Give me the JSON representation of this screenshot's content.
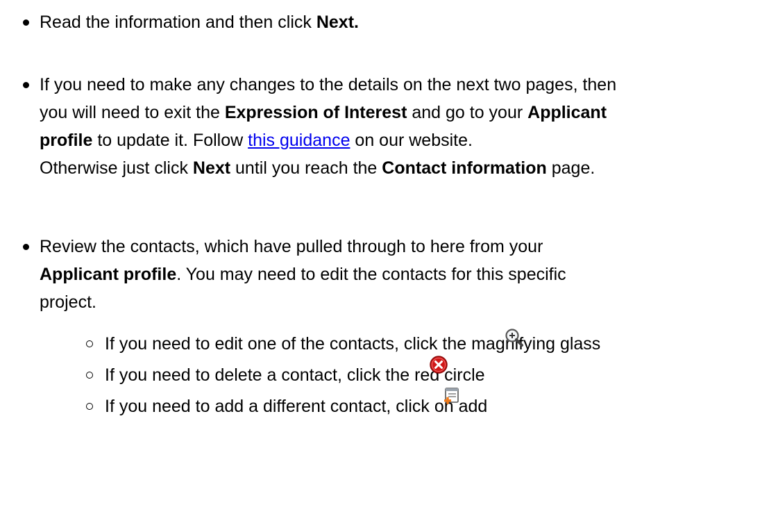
{
  "bullets": [
    {
      "lines": [
        [
          {
            "t": "Read the information and then click "
          },
          {
            "t": "Next.",
            "b": true
          }
        ]
      ]
    },
    {
      "lines": [
        [
          {
            "t": "If you need to make any changes to the details on the next two pages, then"
          }
        ],
        [
          {
            "t": "you will need to exit the "
          },
          {
            "t": "Expression of Interest",
            "b": true
          },
          {
            "t": " and go to your "
          },
          {
            "t": "Applicant",
            "b": true
          }
        ],
        [
          {
            "t": "profile",
            "b": true
          },
          {
            "t": " to update it. Follow "
          },
          {
            "t": "this guidance",
            "link": true
          },
          {
            "t": " on our website."
          }
        ],
        [
          {
            "t": "Otherwise just click "
          },
          {
            "t": "Next",
            "b": true
          },
          {
            "t": " until you reach the "
          },
          {
            "t": "Contact information",
            "b": true
          },
          {
            "t": " page."
          }
        ]
      ]
    },
    {
      "lines": [
        [
          {
            "t": "Review the contacts, which have pulled through to here from your"
          }
        ],
        [
          {
            "t": "Applicant profile",
            "b": true
          },
          {
            "t": ". You may need to edit the contacts for this specific"
          }
        ],
        [
          {
            "t": "project."
          }
        ]
      ]
    }
  ],
  "sub_items": [
    {
      "text": "If you need to edit one of the contacts, click the magnifying glass",
      "icon": "magnifying-glass-icon"
    },
    {
      "text": "If you need to delete a contact, click the red circle",
      "icon": "red-circle-delete-icon"
    },
    {
      "text": "If you need to add a different contact, click on add",
      "icon": "add-contact-icon"
    }
  ],
  "colors": {
    "link": "#0000ee",
    "delete_red": "#d01818",
    "add_orange": "#f07a1a"
  }
}
